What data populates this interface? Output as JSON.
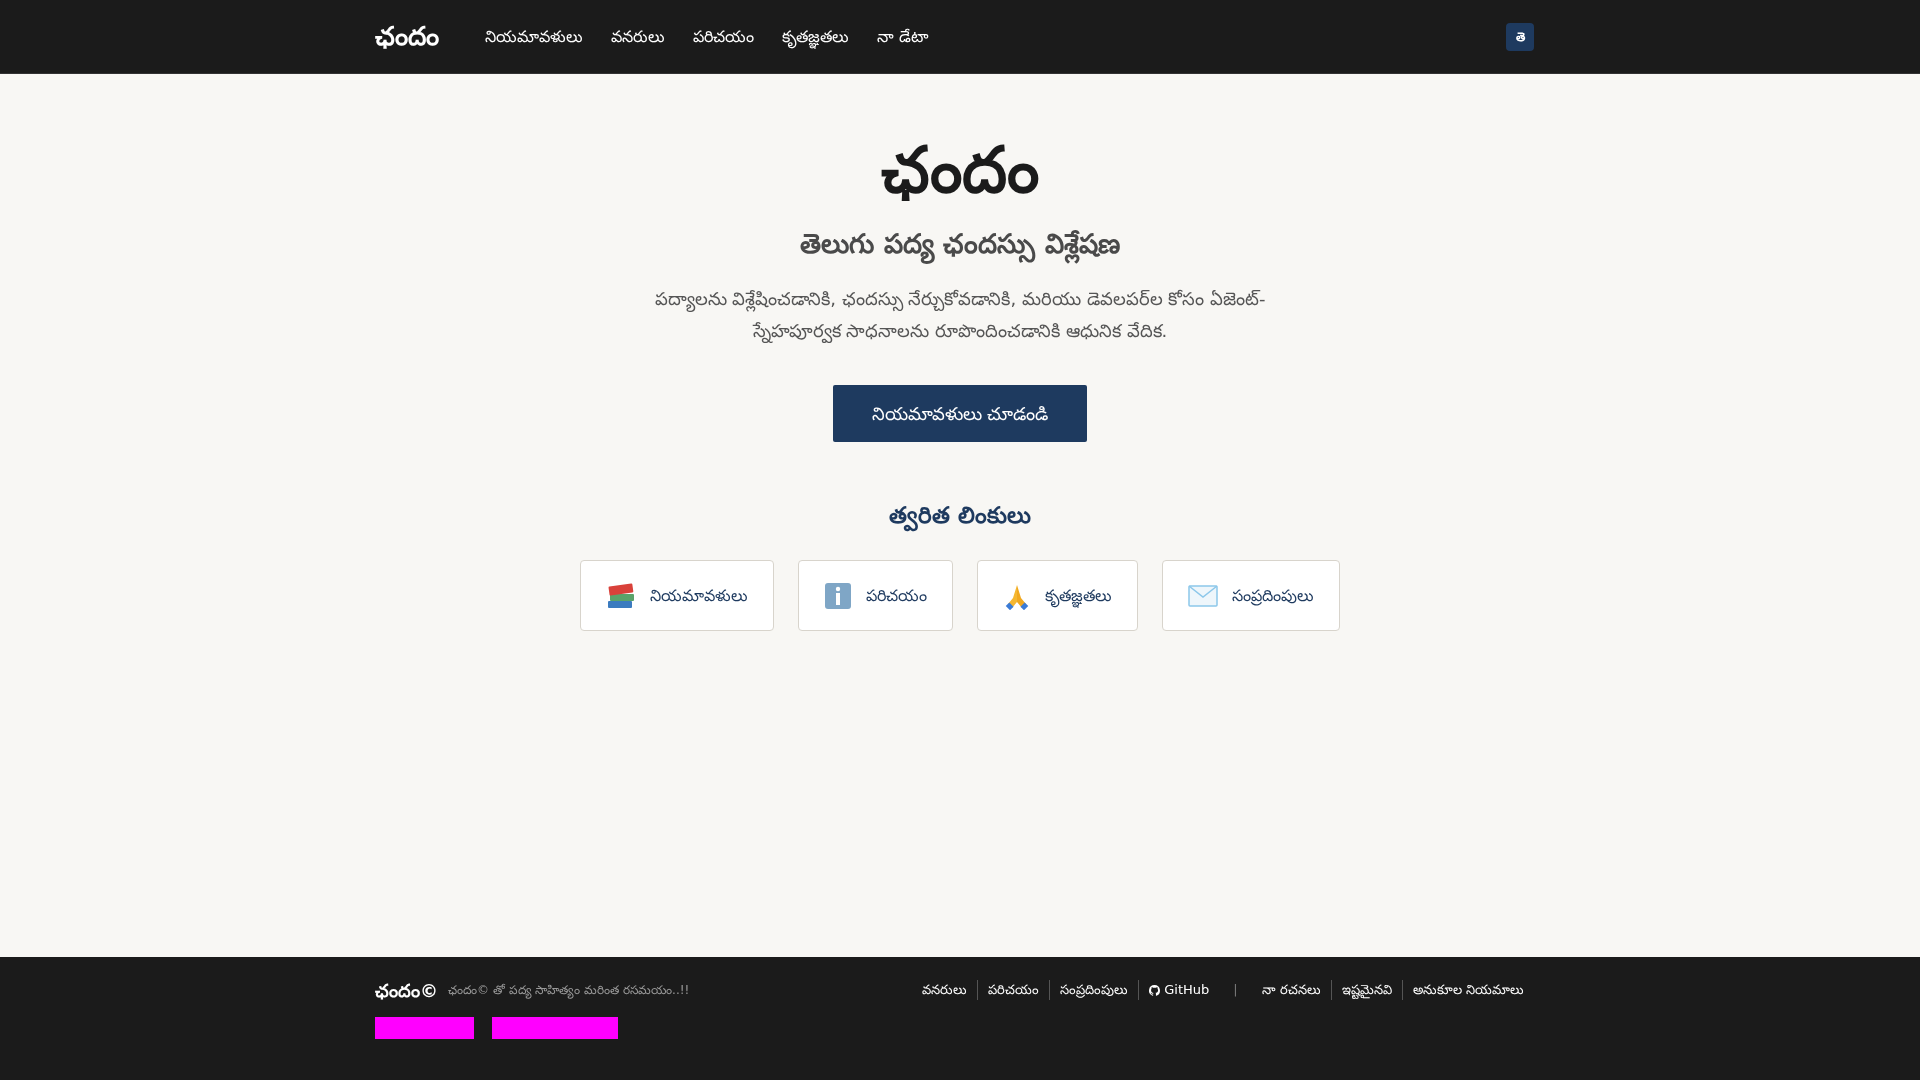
{
  "header": {
    "logo": "ఛందం",
    "nav": [
      {
        "label": "నియమావళులు"
      },
      {
        "label": "వనరులు"
      },
      {
        "label": "పరిచయం"
      },
      {
        "label": "కృతజ్ఞతలు"
      },
      {
        "label": "నా డేటా"
      }
    ],
    "language_button": "తె"
  },
  "hero": {
    "title": "ఛందం",
    "subtitle": "తెలుగు పద్య ఛందస్సు విశ్లేషణ",
    "description": "పద్యాలను విశ్లేషించడానికి, ఛందస్సు నేర్చుకోవడానికి, మరియు డెవలపర్‌ల కోసం ఏజెంట్-స్నేహపూర్వక సాధనాలను రూపొందించడానికి ఆధునిక వేదిక.",
    "button": "నియమావళులు చూడండి"
  },
  "quick_links": {
    "title": "త్వరిత లింకులు",
    "items": [
      {
        "kind": "books",
        "label": "నియమావళులు"
      },
      {
        "kind": "info",
        "label": "పరిచయం"
      },
      {
        "kind": "pray",
        "label": "కృతజ్ఞతలు"
      },
      {
        "kind": "mail",
        "label": "సంప్రదింపులు"
      }
    ]
  },
  "footer": {
    "logo": "ఛందం©",
    "tagline": "ఛందం© తో పద్య సాహిత్యం మరింత రసమయం..!!",
    "links": [
      {
        "kind": "link",
        "label": "వనరులు"
      },
      {
        "kind": "link",
        "label": "పరిచయం"
      },
      {
        "kind": "link",
        "label": "సంప్రదింపులు"
      },
      {
        "kind": "github",
        "label": "GitHub"
      },
      {
        "kind": "separator",
        "label": "|"
      },
      {
        "kind": "link",
        "label": "నా రచనలు"
      },
      {
        "kind": "link",
        "label": "ఇష్టమైనవి"
      },
      {
        "kind": "link",
        "label": "అనుకూల నియమాలు"
      }
    ]
  }
}
